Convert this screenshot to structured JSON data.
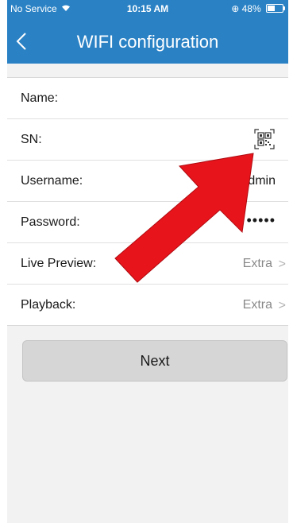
{
  "status_bar": {
    "carrier": "No Service",
    "time": "10:15 AM",
    "battery": "48%"
  },
  "nav": {
    "title": "WIFI configuration"
  },
  "form": {
    "rows": [
      {
        "label": "Name:",
        "value": ""
      },
      {
        "label": "SN:",
        "value": ""
      },
      {
        "label": "Username:",
        "value": "admin"
      },
      {
        "label": "Password:",
        "value": "•••••"
      },
      {
        "label": "Live Preview:",
        "value": "Extra"
      },
      {
        "label": "Playback:",
        "value": "Extra"
      }
    ]
  },
  "actions": {
    "next_label": "Next"
  },
  "colors": {
    "nav_bar": "#2a82c5",
    "arrow": "#e8141b",
    "button_bg": "#d6d6d6"
  },
  "icons": {
    "back": "chevron-left-icon",
    "sn_scan": "qr-code-scan-icon",
    "chevron": "chevron-right-icon",
    "wifi": "wifi-icon",
    "battery": "battery-icon"
  }
}
